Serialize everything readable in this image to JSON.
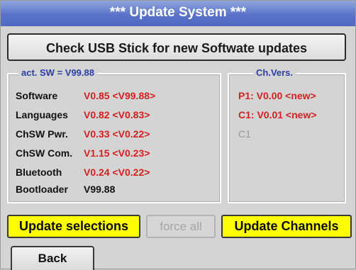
{
  "window": {
    "title": "***   Update System   ***"
  },
  "check_button": {
    "label": "Check USB Stick for new Softwate updates"
  },
  "sw_group": {
    "legend": "act. SW = V99.88",
    "rows": [
      {
        "label": "Software",
        "value": "V0.85 <V99.88>",
        "highlight": true
      },
      {
        "label": "Languages",
        "value": "V0.82 <V0.83>",
        "highlight": true
      },
      {
        "label": "ChSW Pwr.",
        "value": "V0.33 <V0.22>",
        "highlight": true
      },
      {
        "label": "ChSW Com.",
        "value": "V1.15 <V0.23>",
        "highlight": true
      },
      {
        "label": "Bluetooth",
        "value": "V0.24 <V0.22>",
        "highlight": true
      },
      {
        "label": "Bootloader",
        "value": "V99.88",
        "highlight": false
      }
    ]
  },
  "ch_group": {
    "legend": "Ch.Vers.",
    "items": [
      {
        "text": "P1: V0.00 <new>",
        "active": true
      },
      {
        "text": "C1: V0.01 <new>",
        "active": true
      },
      {
        "text": "C1",
        "active": false
      }
    ]
  },
  "actions": {
    "update_selections": "Update selections",
    "force_all": "force all",
    "update_channels": "Update Channels",
    "back": "Back"
  },
  "colors": {
    "title_bar": "#5a73c9",
    "highlight_value": "#d61f1f",
    "legend_text": "#2c3ea8",
    "action_button": "#ffff00"
  }
}
